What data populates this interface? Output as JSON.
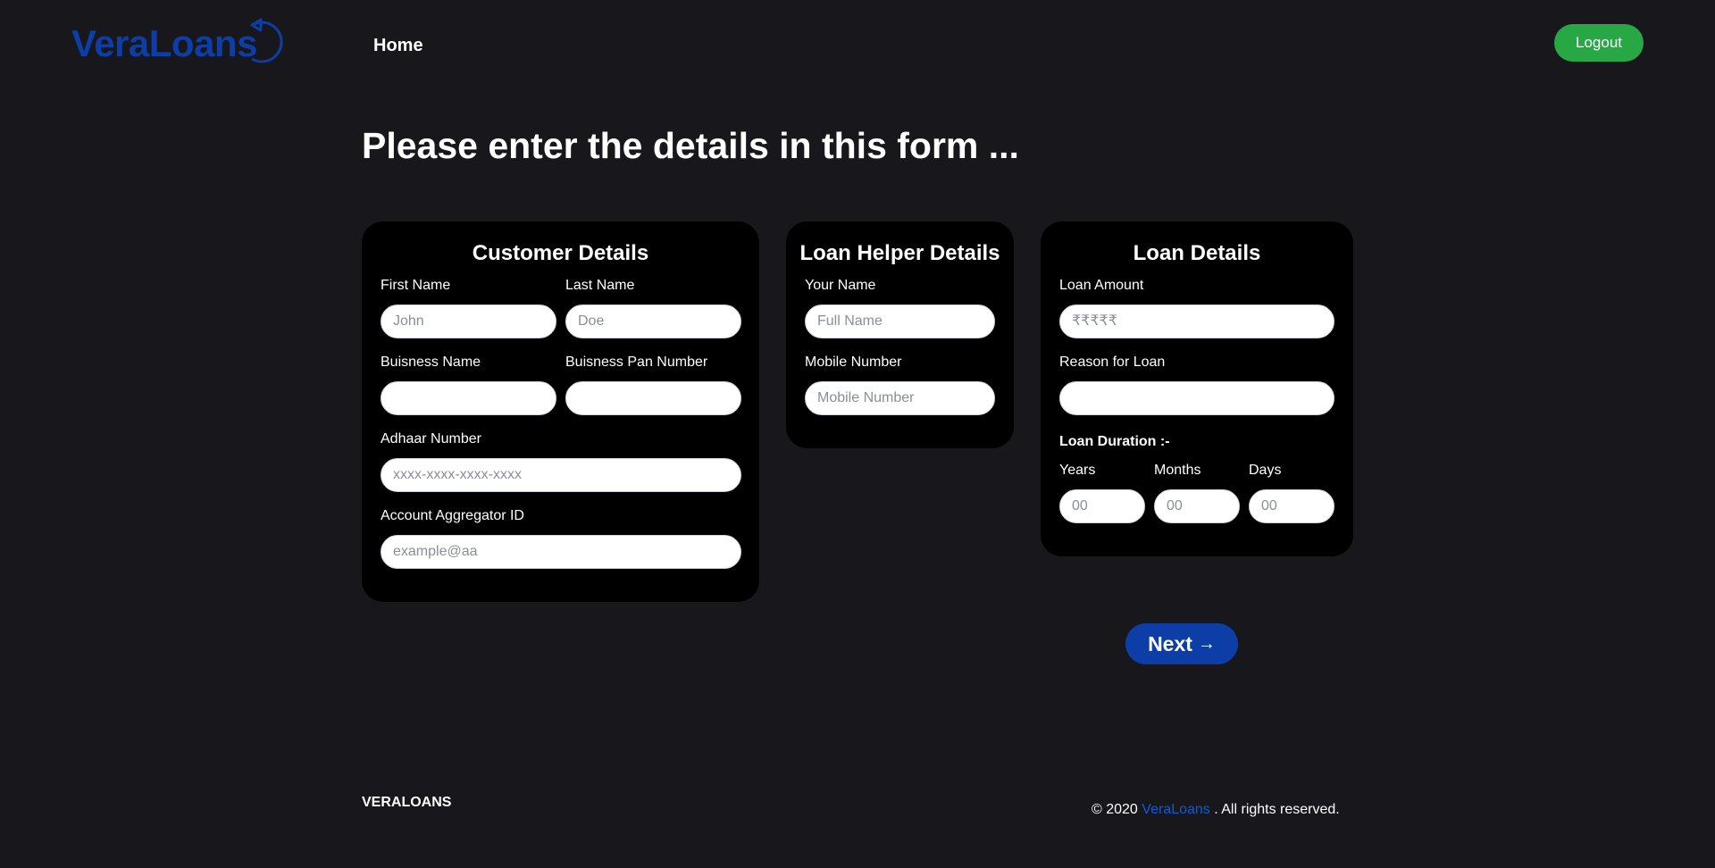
{
  "header": {
    "logo_text": "VeraLoans",
    "nav_home": "Home",
    "logout_label": "Logout"
  },
  "page_heading": "Please enter the details in this form ...",
  "customer": {
    "title": "Customer Details",
    "first_name_label": "First Name",
    "first_name_placeholder": "John",
    "last_name_label": "Last Name",
    "last_name_placeholder": "Doe",
    "business_name_label": "Buisness Name",
    "business_name_value": "",
    "business_pan_label": "Buisness Pan Number",
    "business_pan_value": "",
    "adhaar_label": "Adhaar Number",
    "adhaar_placeholder": "xxxx-xxxx-xxxx-xxxx",
    "aa_id_label": "Account Aggregator ID",
    "aa_id_placeholder": "example@aa"
  },
  "helper": {
    "title": "Loan Helper Details",
    "name_label": "Your Name",
    "name_placeholder": "Full Name",
    "mobile_label": "Mobile Number",
    "mobile_placeholder": "Mobile Number"
  },
  "loan": {
    "title": "Loan Details",
    "amount_label": "Loan Amount",
    "amount_placeholder": "₹₹₹₹₹",
    "reason_label": "Reason for Loan",
    "reason_value": "",
    "duration_label": "Loan Duration :-",
    "years_label": "Years",
    "years_placeholder": "00",
    "months_label": "Months",
    "months_placeholder": "00",
    "days_label": "Days",
    "days_placeholder": "00"
  },
  "next_label": "Next",
  "footer": {
    "brand": "VERALOANS",
    "copy_prefix": "© 2020",
    "copy_link": "VeraLoans",
    "copy_suffix": ". All rights reserved."
  },
  "colors": {
    "background": "#17171c",
    "card": "#000000",
    "brand_blue": "#0d3ea8",
    "logout_green": "#28a745"
  },
  "icons": {
    "logo_arrow": "circular-arrow-icon",
    "next_arrow": "arrow-right-icon"
  }
}
